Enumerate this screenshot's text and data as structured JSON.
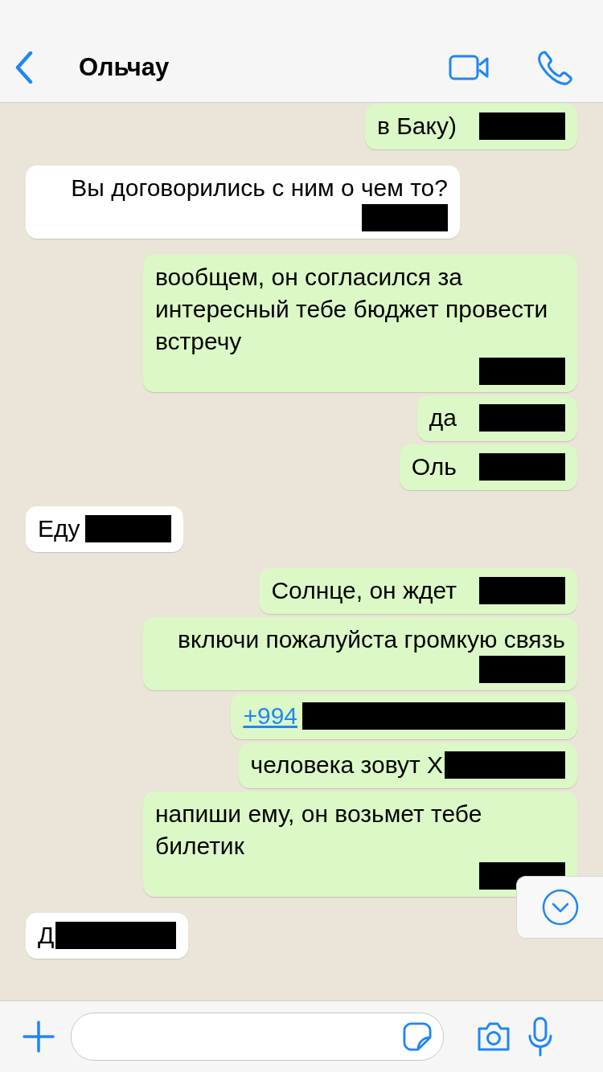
{
  "header": {
    "title": "Ольчау"
  },
  "messages": [
    {
      "kind": "outgoing",
      "text": "в Баку)",
      "link": false,
      "redaction": {
        "kind": "short"
      }
    },
    {
      "kind": "incoming",
      "text": "Вы договорились с ним о чем то?",
      "link": false,
      "redaction": {
        "kind": "short"
      }
    },
    {
      "kind": "outgoing",
      "text": "вообщем, он согласился за интересный тебе бюджет провести встречу",
      "link": false,
      "redaction": {
        "kind": "short"
      }
    },
    {
      "kind": "outgoing",
      "text": "да",
      "link": false,
      "redaction": {
        "kind": "short"
      }
    },
    {
      "kind": "outgoing",
      "text": "Оль",
      "link": false,
      "redaction": {
        "kind": "short"
      }
    },
    {
      "kind": "incoming",
      "text": "Еду",
      "link": false,
      "redaction": {
        "kind": "inline"
      }
    },
    {
      "kind": "outgoing",
      "text": "Солнце, он ждет",
      "link": false,
      "redaction": {
        "kind": "short"
      }
    },
    {
      "kind": "outgoing",
      "text": "включи пожалуйста громкую связь",
      "link": false,
      "redaction": {
        "kind": "short"
      }
    },
    {
      "kind": "outgoing",
      "text": "+994",
      "link": true,
      "redaction": {
        "kind": "long"
      }
    },
    {
      "kind": "outgoing",
      "text": "человека зовут Х",
      "link": false,
      "redaction": {
        "kind": "medium"
      }
    },
    {
      "kind": "outgoing",
      "text": "напиши ему, он возьмет тебе билетик",
      "link": false,
      "redaction": {
        "kind": "short"
      }
    },
    {
      "kind": "incoming",
      "text": "Д",
      "link": false,
      "redaction": {
        "kind": "medium"
      }
    }
  ]
}
